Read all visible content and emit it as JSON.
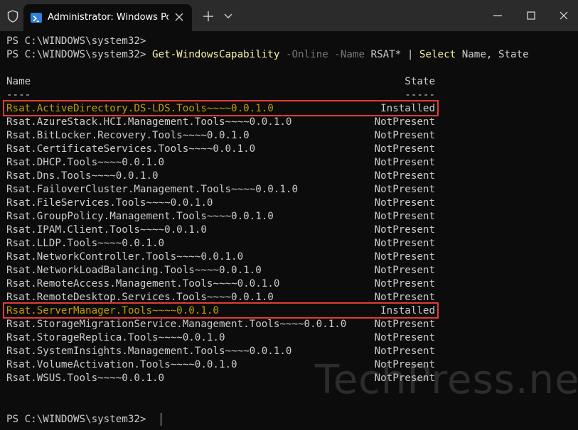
{
  "window": {
    "tab_title": "Administrator: Windows Powe",
    "icons": [
      "shield-icon",
      "powershell-icon",
      "close-icon",
      "plus-icon",
      "chevron-down-icon",
      "minimize-icon",
      "maximize-icon",
      "close-window-icon"
    ]
  },
  "terminal": {
    "prompt1": "PS C:\\WINDOWS\\system32>",
    "prompt2": "PS C:\\WINDOWS\\system32>",
    "command": {
      "cmdlet": "Get-WindowsCapability",
      "online_flag": "-Online",
      "name_flag": "-Name",
      "name_value": "RSAT*",
      "pipe": "|",
      "select": "Select",
      "select_args": "Name, State"
    },
    "header_name": "Name",
    "header_state": "State",
    "underline_name": "----",
    "underline_state": "-----",
    "rows": [
      {
        "name": "Rsat.ActiveDirectory.DS-LDS.Tools~~~~0.0.1.0",
        "state": "Installed"
      },
      {
        "name": "Rsat.AzureStack.HCI.Management.Tools~~~~0.0.1.0",
        "state": "NotPresent"
      },
      {
        "name": "Rsat.BitLocker.Recovery.Tools~~~~0.0.1.0",
        "state": "NotPresent"
      },
      {
        "name": "Rsat.CertificateServices.Tools~~~~0.0.1.0",
        "state": "NotPresent"
      },
      {
        "name": "Rsat.DHCP.Tools~~~~0.0.1.0",
        "state": "NotPresent"
      },
      {
        "name": "Rsat.Dns.Tools~~~~0.0.1.0",
        "state": "NotPresent"
      },
      {
        "name": "Rsat.FailoverCluster.Management.Tools~~~~0.0.1.0",
        "state": "NotPresent"
      },
      {
        "name": "Rsat.FileServices.Tools~~~~0.0.1.0",
        "state": "NotPresent"
      },
      {
        "name": "Rsat.GroupPolicy.Management.Tools~~~~0.0.1.0",
        "state": "NotPresent"
      },
      {
        "name": "Rsat.IPAM.Client.Tools~~~~0.0.1.0",
        "state": "NotPresent"
      },
      {
        "name": "Rsat.LLDP.Tools~~~~0.0.1.0",
        "state": "NotPresent"
      },
      {
        "name": "Rsat.NetworkController.Tools~~~~0.0.1.0",
        "state": "NotPresent"
      },
      {
        "name": "Rsat.NetworkLoadBalancing.Tools~~~~0.0.1.0",
        "state": "NotPresent"
      },
      {
        "name": "Rsat.RemoteAccess.Management.Tools~~~~0.0.1.0",
        "state": "NotPresent"
      },
      {
        "name": "Rsat.RemoteDesktop.Services.Tools~~~~0.0.1.0",
        "state": "NotPresent"
      },
      {
        "name": "Rsat.ServerManager.Tools~~~~0.0.1.0",
        "state": "Installed"
      },
      {
        "name": "Rsat.StorageMigrationService.Management.Tools~~~~0.0.1.0",
        "state": "NotPresent"
      },
      {
        "name": "Rsat.StorageReplica.Tools~~~~0.0.1.0",
        "state": "NotPresent"
      },
      {
        "name": "Rsat.SystemInsights.Management.Tools~~~~0.0.1.0",
        "state": "NotPresent"
      },
      {
        "name": "Rsat.VolumeActivation.Tools~~~~0.0.1.0",
        "state": "NotPresent"
      },
      {
        "name": "Rsat.WSUS.Tools~~~~0.0.1.0",
        "state": "NotPresent"
      }
    ]
  },
  "watermark": "TechPress.net",
  "colors": {
    "background": "#0c0c0c",
    "text": "#cccccc",
    "cmdlet": "#f9f1a5",
    "parameter": "#767676",
    "installed": "#c19c00",
    "highlight_box": "#e53935"
  }
}
